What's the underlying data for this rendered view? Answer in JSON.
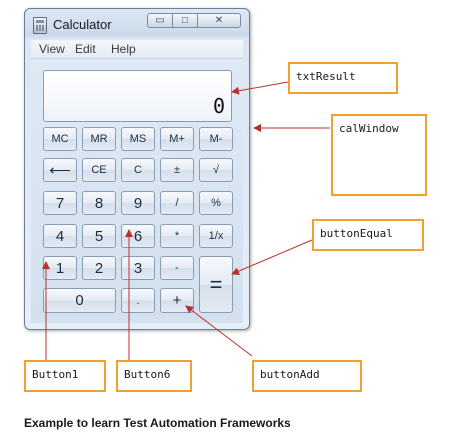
{
  "window": {
    "title": "Calculator",
    "min_glyph": "▭",
    "max_glyph": "□",
    "close_glyph": "✕"
  },
  "menu": {
    "items": [
      "View",
      "Edit",
      "Help"
    ]
  },
  "display": {
    "value": "0"
  },
  "keys": {
    "mc": "MC",
    "mr": "MR",
    "ms": "MS",
    "mplus": "M+",
    "mminus": "M-",
    "back": "⟵",
    "ce": "CE",
    "c": "C",
    "plusminus": "±",
    "sqrt": "√",
    "n7": "7",
    "n8": "8",
    "n9": "9",
    "div": "/",
    "pct": "%",
    "n4": "4",
    "n5": "5",
    "n6": "6",
    "mul": "*",
    "recip": "1/x",
    "n1": "1",
    "n2": "2",
    "n3": "3",
    "sub": "-",
    "eq": "=",
    "n0": "0",
    "dot": ".",
    "add": "+"
  },
  "annotations": {
    "txtResult": "txtResult",
    "calWindow": "calWindow",
    "buttonEqual": "buttonEqual",
    "button1": "Button1",
    "button6": "Button6",
    "buttonAdd": "buttonAdd"
  },
  "caption": "Example to learn Test Automation Frameworks",
  "colors": {
    "annotation_border": "#f0a030",
    "arrow": "#b8322d"
  }
}
